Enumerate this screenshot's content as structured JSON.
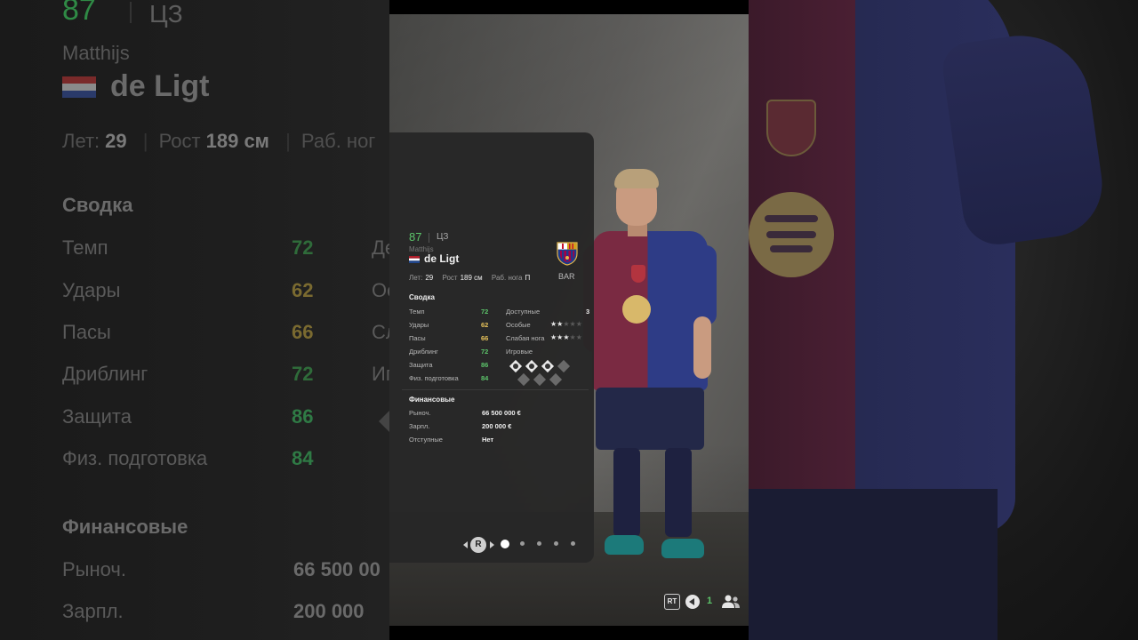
{
  "player": {
    "overall": "87",
    "position": "ЦЗ",
    "first_name": "Matthijs",
    "last_name": "de Ligt",
    "club_abbr": "BAR",
    "bio": {
      "age_label": "Лет:",
      "age": "29",
      "height_label": "Рост",
      "height": "189 см",
      "foot_label": "Раб. нога",
      "foot": "П"
    }
  },
  "summary": {
    "title": "Сводка",
    "stats": [
      {
        "label": "Темп",
        "value": "72"
      },
      {
        "label": "Удары",
        "value": "62"
      },
      {
        "label": "Пасы",
        "value": "66"
      },
      {
        "label": "Дриблинг",
        "value": "72"
      },
      {
        "label": "Защита",
        "value": "86"
      },
      {
        "label": "Физ. подготовка",
        "value": "84"
      }
    ],
    "right": {
      "available_label": "Доступные",
      "available_value": "3",
      "special_label": "Особые",
      "special_stars": 2,
      "weak_foot_label": "Слабая нога",
      "weak_foot_stars": 3,
      "playstyles_label": "Игровые",
      "playstyles_active": 3,
      "playstyles_total": 7
    }
  },
  "finance": {
    "title": "Финансовые",
    "rows": [
      {
        "label": "Рыноч.",
        "value": "66 500 000 €"
      },
      {
        "label": "Зарпл.",
        "value": "200 000 €"
      },
      {
        "label": "Отступные",
        "value": "Нет"
      }
    ]
  },
  "pager": {
    "button_label": "R",
    "pages": 5,
    "active": 0
  },
  "hud": {
    "rt_label": "RT",
    "count": "1"
  },
  "background_blur": {
    "info_partial": "Раб. ног",
    "right_partials": [
      "Де",
      "Ос",
      "Сл",
      "Иг"
    ],
    "finance_values": [
      "66 500 00",
      "200 000"
    ]
  },
  "colors": {
    "stat_green": "#5cc46a",
    "stat_yellow": "#e8c35a",
    "panel_bg": "#262626",
    "barca_red": "#7a2a42",
    "barca_blue": "#2e3c86"
  }
}
